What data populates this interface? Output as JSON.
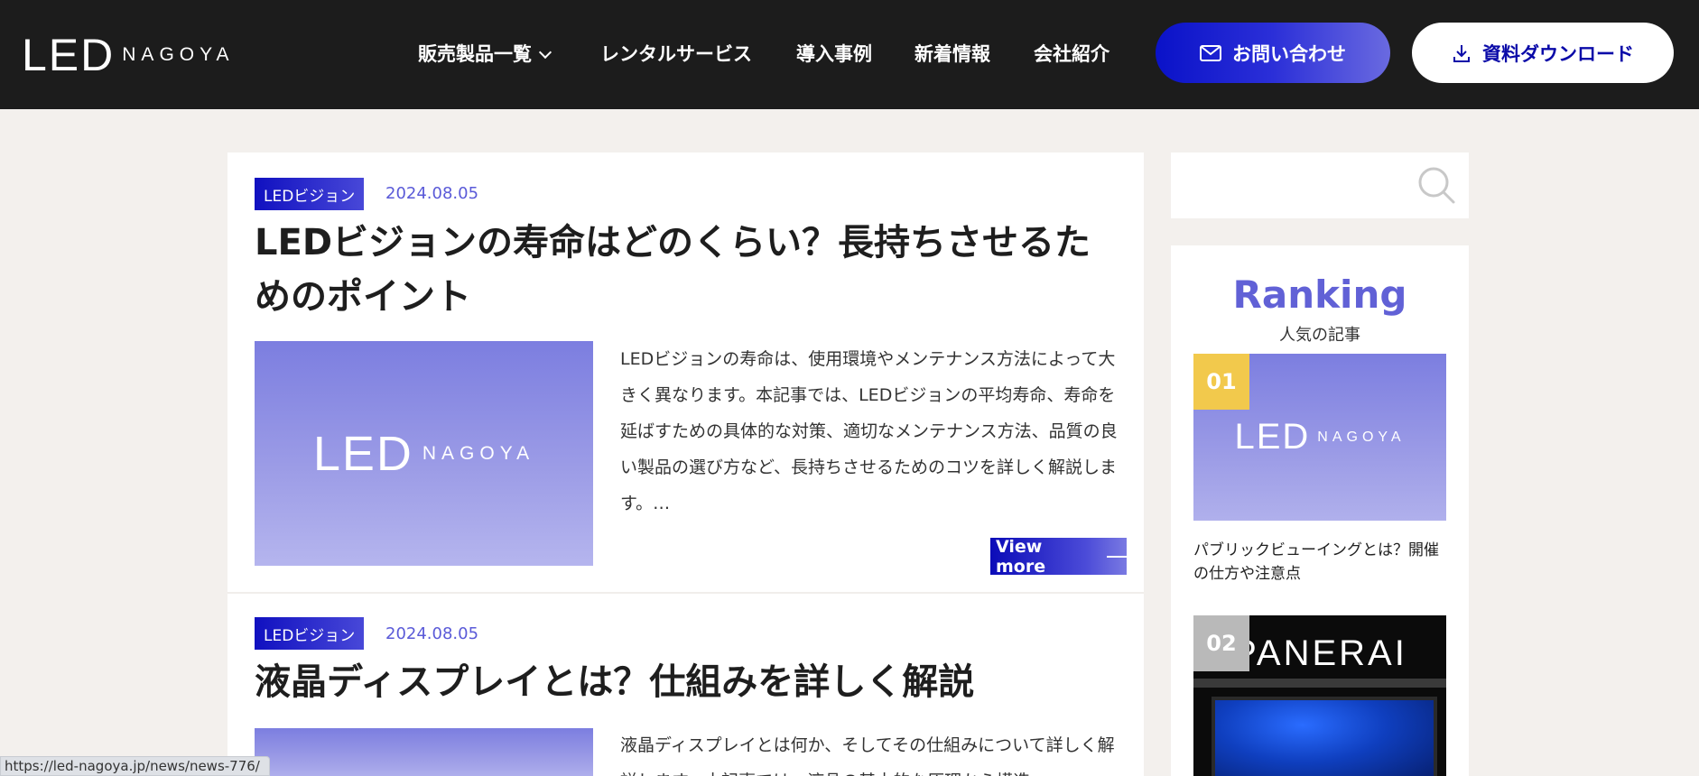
{
  "header": {
    "logo_led": "LED",
    "logo_nagoya": "NAGOYA",
    "nav": [
      {
        "label": "販売製品一覧"
      },
      {
        "label": "レンタルサービス"
      },
      {
        "label": "導入事例"
      },
      {
        "label": "新着情報"
      },
      {
        "label": "会社紹介"
      }
    ],
    "contact_label": "お問い合わせ",
    "download_label": "資料ダウンロード"
  },
  "articles": [
    {
      "category": "LEDビジョン",
      "date": "2024.08.05",
      "title": "LEDビジョンの寿命はどのくらい？長持ちさせるためのポイント",
      "excerpt": "LEDビジョンの寿命は、使用環境やメンテナンス方法によって大きく異なります。本記事では、LEDビジョンの平均寿命、寿命を延ばすための具体的な対策、適切なメンテナンス方法、品質の良い製品の選び方など、長持ちさせるためのコツを詳しく解説します。…",
      "view_more": "View more",
      "thumb_led": "LED",
      "thumb_nagoya": "NAGOYA"
    },
    {
      "category": "LEDビジョン",
      "date": "2024.08.05",
      "title": "液晶ディスプレイとは？仕組みを詳しく解説",
      "excerpt": "液晶ディスプレイとは何か、そしてその仕組みについて詳しく解説します。本記事では、液晶の基本的な原理から構造"
    }
  ],
  "sidebar": {
    "ranking_title": "Ranking",
    "ranking_subtitle": "人気の記事",
    "items": [
      {
        "rank": "01",
        "title": "パブリックビューイングとは？開催の仕方や注意点",
        "thumb_led": "LED",
        "thumb_nagoya": "NAGOYA"
      },
      {
        "rank": "02",
        "thumb_sign": "PANERAI"
      }
    ]
  },
  "status_url": "https://led-nagoya.jp/news/news-776/",
  "colors": {
    "header_bg": "#1c1c1c",
    "accent_blue": "#0a12c8",
    "date_purple": "#5a5ad8",
    "ranking_purple": "#6161d6",
    "rank_gold": "#f2c94c",
    "rank_silver": "#b9b9b9"
  },
  "icons": [
    "mail-icon",
    "download-icon",
    "search-icon",
    "chevron-down-icon"
  ]
}
